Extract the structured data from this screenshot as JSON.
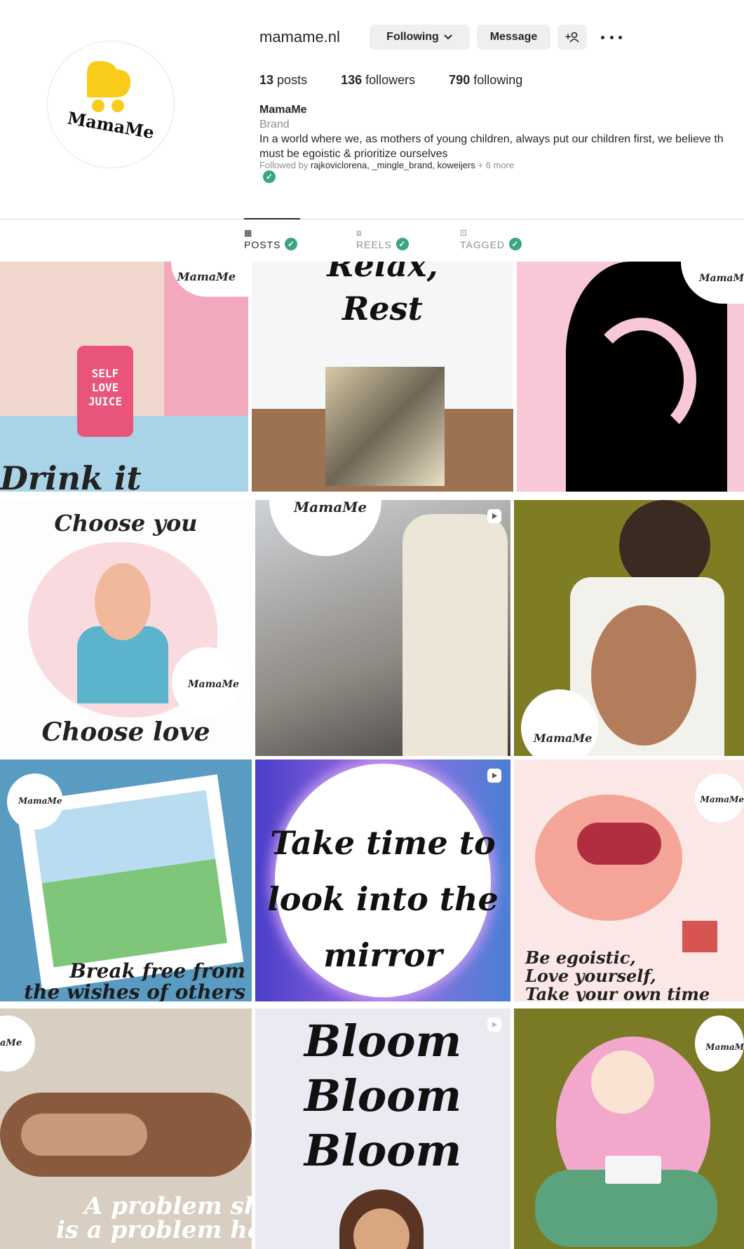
{
  "profile": {
    "username": "mamame.nl",
    "logo_text": "MamaMe",
    "name": "MamaMe",
    "category": "Brand",
    "bio": "In a world where we, as mothers of young children, always put our children first, we believe th must be egoistic & prioritize ourselves",
    "followed_by_prefix": "Followed by",
    "followed_by_users": "rajkoviclorena, _mingle_brand, koweijers",
    "followed_by_more": "+ 6 more"
  },
  "actions": {
    "following_label": "Following",
    "message_label": "Message",
    "add_user_label": "+𝓞"
  },
  "stats": {
    "posts_count": "13",
    "posts_label": "posts",
    "followers_count": "136",
    "followers_label": "followers",
    "following_count": "790",
    "following_label": "following"
  },
  "tabs": [
    {
      "label": "POSTS",
      "icon": "grid-icon"
    },
    {
      "label": "REELS",
      "icon": "reels-icon"
    },
    {
      "label": "TAGGED",
      "icon": "tagged-icon"
    }
  ],
  "posts": {
    "p1": {
      "text": "Drink it",
      "can": [
        "SELF",
        "LOVE",
        "JUICE"
      ],
      "logo": "MamaMe"
    },
    "p2": {
      "line1": "Relax,",
      "line2": "Rest"
    },
    "p3": {
      "logo": "MamaM"
    },
    "p4": {
      "top": "Choose you",
      "bottom": "Choose love",
      "logo": "MamaMe"
    },
    "p5": {
      "logo": "MamaMe"
    },
    "p6": {
      "logo": "MamaMe"
    },
    "p7": {
      "line1": "Break free from",
      "line2": "the wishes of others",
      "logo": "MamaMe"
    },
    "p8": {
      "line1": "Take time to",
      "line2": "look into the",
      "line3": "mirror"
    },
    "p9": {
      "line1": "Be egoistic,",
      "line2": "Love yourself,",
      "line3": "Take your own time",
      "logo": "MamaMe"
    },
    "p10": {
      "line1": "A problem sha",
      "line2": "is a problem halv",
      "logo": "aMe"
    },
    "p11": {
      "line1": "Bloom",
      "line2": "Bloom",
      "line3": "Bloom"
    },
    "p12": {
      "logo": "MamaM"
    }
  },
  "colors": {
    "brand_yellow": "#f9cc1c",
    "verified_green": "#3aa680",
    "button_gray": "#efefef"
  }
}
